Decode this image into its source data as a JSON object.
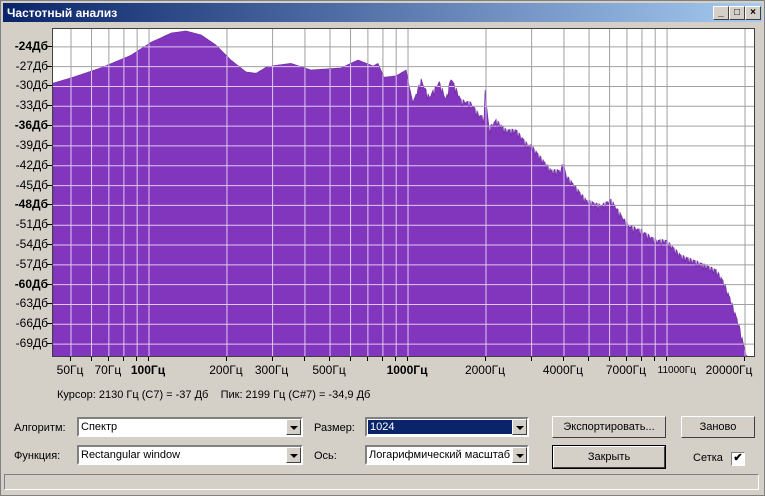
{
  "window": {
    "title": "Частотный анализ",
    "minimize": "_",
    "maximize": "□",
    "close": "×"
  },
  "colors": {
    "fill": "#8236bd",
    "grid_on_fill": "#e0c8f0",
    "grid_on_bg": "#a0a0a0",
    "titlebar": "#0a246a"
  },
  "chart_data": {
    "type": "area",
    "title": "Частотный анализ",
    "xscale": "log",
    "xlim": [
      42.6,
      22050
    ],
    "ylim": [
      -71.1,
      -21.3
    ],
    "grid": true,
    "y_ticks": [
      {
        "v": -24,
        "label": "-24Дб",
        "bold": true
      },
      {
        "v": -27,
        "label": "-27Дб",
        "bold": false
      },
      {
        "v": -30,
        "label": "-30Дб",
        "bold": false
      },
      {
        "v": -33,
        "label": "-33Дб",
        "bold": false
      },
      {
        "v": -36,
        "label": "-36Дб",
        "bold": true
      },
      {
        "v": -39,
        "label": "-39Дб",
        "bold": false
      },
      {
        "v": -42,
        "label": "-42Дб",
        "bold": false
      },
      {
        "v": -45,
        "label": "-45Дб",
        "bold": false
      },
      {
        "v": -48,
        "label": "-48Дб",
        "bold": true
      },
      {
        "v": -51,
        "label": "-51Дб",
        "bold": false
      },
      {
        "v": -54,
        "label": "-54Дб",
        "bold": false
      },
      {
        "v": -57,
        "label": "-57Дб",
        "bold": false
      },
      {
        "v": -60,
        "label": "-60Дб",
        "bold": true
      },
      {
        "v": -63,
        "label": "-63Дб",
        "bold": false
      },
      {
        "v": -66,
        "label": "-66Дб",
        "bold": false
      },
      {
        "v": -69,
        "label": "-69Дб",
        "bold": false
      }
    ],
    "x_ticks": [
      {
        "v": 50,
        "label": "50Гц",
        "style": ""
      },
      {
        "v": 70,
        "label": "70Гц",
        "style": ""
      },
      {
        "v": 100,
        "label": "100Гц",
        "style": "b"
      },
      {
        "v": 200,
        "label": "200Гц",
        "style": ""
      },
      {
        "v": 300,
        "label": "300Гц",
        "style": ""
      },
      {
        "v": 500,
        "label": "500Гц",
        "style": ""
      },
      {
        "v": 1000,
        "label": "1000Гц",
        "style": "b"
      },
      {
        "v": 2000,
        "label": "2000Гц",
        "style": ""
      },
      {
        "v": 4000,
        "label": "4000Гц",
        "style": ""
      },
      {
        "v": 7000,
        "label": "7000Гц",
        "style": ""
      },
      {
        "v": 11000,
        "label": "11000Гц",
        "style": "s"
      },
      {
        "v": 20000,
        "label": "20000Гц",
        "style": ""
      }
    ],
    "x_grid": [
      50,
      60,
      70,
      80,
      90,
      100,
      200,
      300,
      400,
      500,
      600,
      700,
      800,
      900,
      1000,
      2000,
      3000,
      4000,
      5000,
      6000,
      7000,
      8000,
      9000,
      10000,
      20000
    ],
    "series": [
      {
        "name": "Спектр",
        "freq": [
          42.6,
          50,
          65,
          85,
          102,
          122,
          139,
          159,
          181,
          207,
          237,
          259,
          283,
          309,
          353,
          422,
          551,
          641,
          733,
          766,
          808,
          899,
          983,
          1009,
          1045,
          1123,
          1206,
          1318,
          1402,
          1466,
          1603,
          1750,
          1880,
          1966,
          1984,
          2054,
          2187,
          2390,
          2612,
          2904,
          2985,
          3565,
          3899,
          3966,
          4074,
          4866,
          5560,
          6076,
          7067,
          7943,
          9072,
          9916,
          11333,
          13527,
          15460,
          16450,
          17660,
          18970,
          20190,
          20760,
          22050
        ],
        "db": [
          -29.5,
          -28.7,
          -27.2,
          -25.3,
          -23.3,
          -21.9,
          -21.6,
          -22.2,
          -23.7,
          -26.0,
          -27.8,
          -28.0,
          -27.1,
          -26.8,
          -26.5,
          -27.5,
          -27.2,
          -26.0,
          -26.9,
          -26.5,
          -28.6,
          -28.4,
          -27.5,
          -29.8,
          -32.5,
          -29.0,
          -31.6,
          -29.3,
          -31.9,
          -28.7,
          -32.1,
          -32.5,
          -34.3,
          -34.7,
          -30.6,
          -36.3,
          -35.1,
          -36.6,
          -36.6,
          -38.9,
          -38.9,
          -42.7,
          -42.7,
          -41.2,
          -43.4,
          -47.2,
          -48.0,
          -47.2,
          -51.0,
          -51.8,
          -53.3,
          -53.3,
          -55.6,
          -56.8,
          -57.8,
          -59.4,
          -62.4,
          -66.2,
          -70.7,
          -71.0,
          -71.0
        ]
      }
    ]
  },
  "info": {
    "cursor": "Курсор: 2130 Гц (C7) = -37 Дб",
    "peak": "Пик: 2199 Гц (C#7) = -34,9 Дб"
  },
  "controls": {
    "algorithm_label": "Алгоритм:",
    "algorithm_value": "Спектр",
    "function_label": "Функция:",
    "function_value": "Rectangular window",
    "size_label": "Размер:",
    "size_value": "1024",
    "axis_label": "Ось:",
    "axis_value": "Логарифмический масштаб",
    "export_button": "Экспортировать...",
    "redo_button": "Заново",
    "close_button": "Закрыть",
    "grid_label": "Сетка",
    "grid_checked": "✔"
  }
}
